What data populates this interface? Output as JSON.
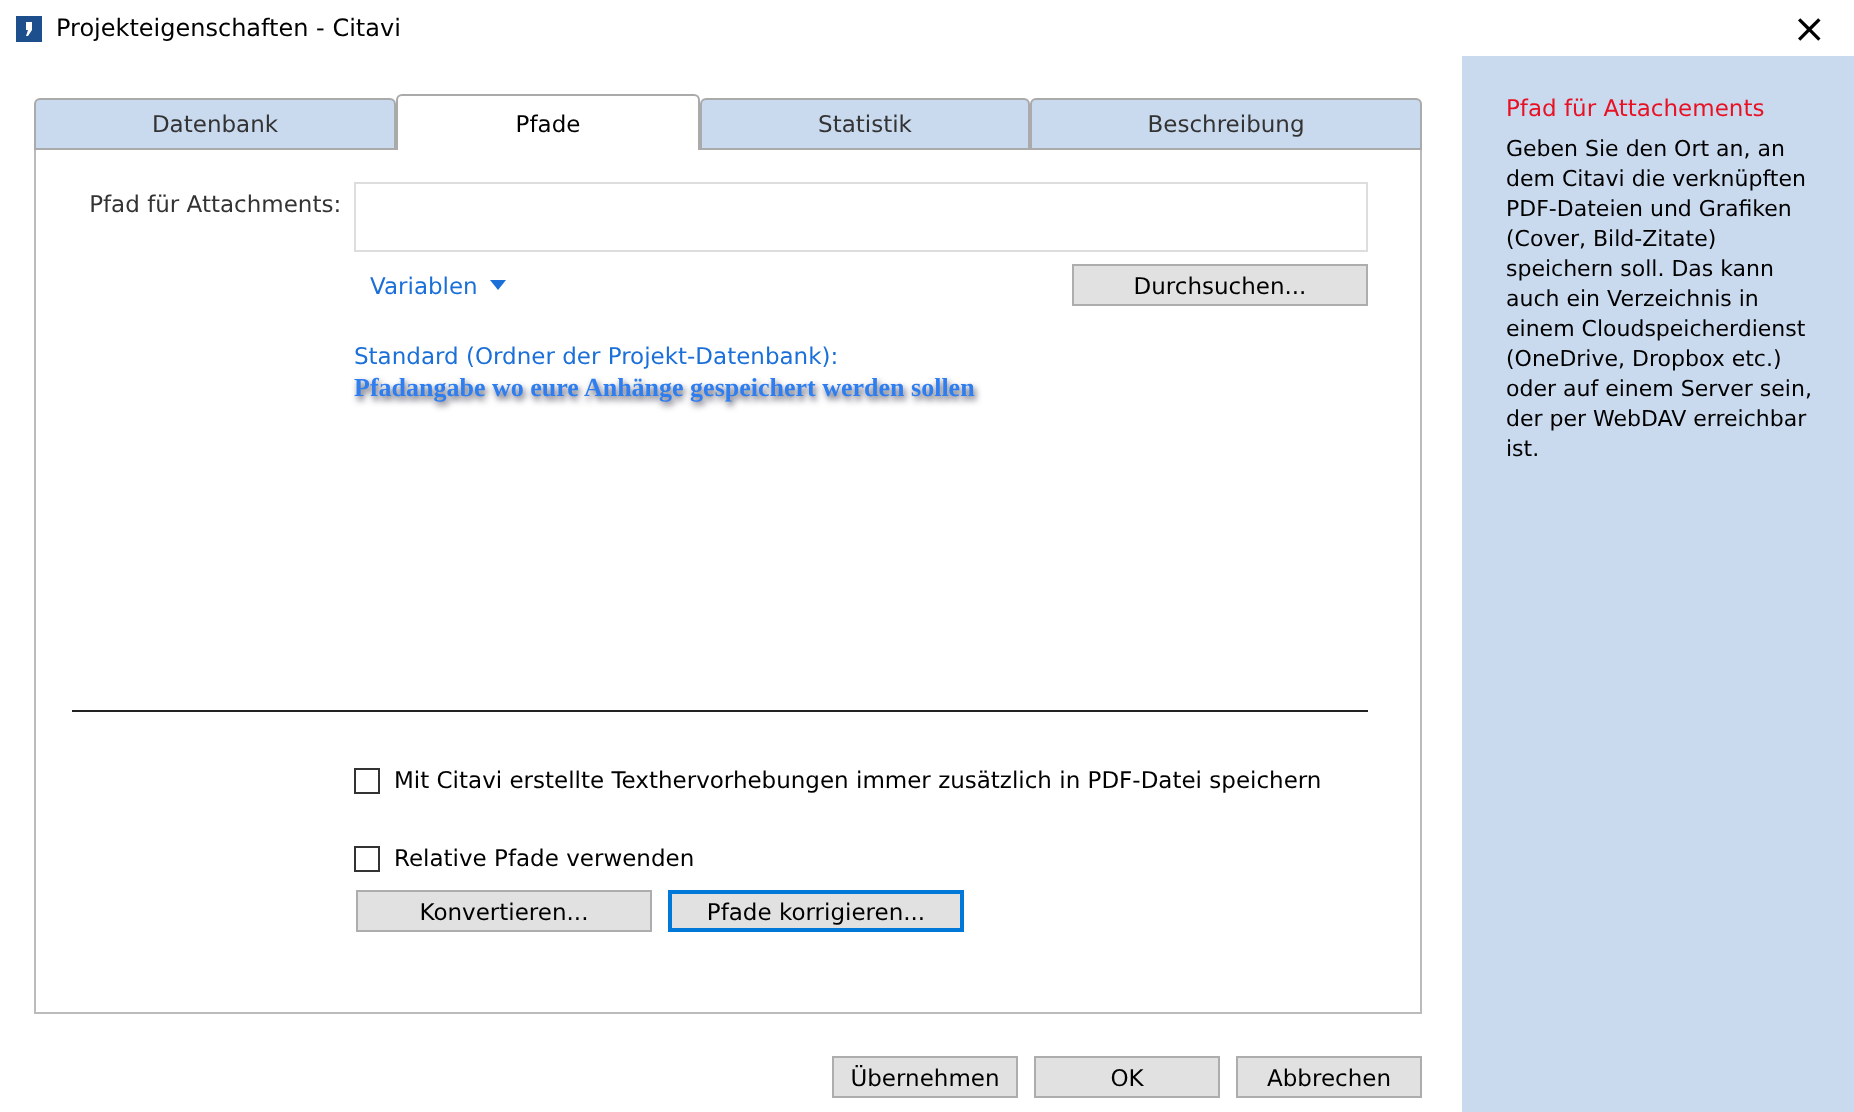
{
  "window": {
    "title": "Projekteigenschaften - Citavi",
    "close": "×"
  },
  "tabs": [
    {
      "label": "Datenbank",
      "selected": false
    },
    {
      "label": "Pfade",
      "selected": true
    },
    {
      "label": "Statistik",
      "selected": false
    },
    {
      "label": "Beschreibung",
      "selected": false
    }
  ],
  "attachment_path": {
    "label": "Pfad für Attachments:",
    "variables": "Variablen",
    "browse": "Durchsuchen...",
    "default_label": "Standard (Ordner der Projekt-Datenbank):",
    "annotation": "Pfadangabe wo eure Anhänge gespeichert werden sollen"
  },
  "checkboxes": [
    {
      "label": "Mit Citavi erstellte Texthervorhebungen immer zusätzlich in PDF-Datei speichern",
      "checked": false
    },
    {
      "label": "Relative Pfade verwenden",
      "checked": false
    }
  ],
  "path_buttons": [
    {
      "label": "Konvertieren...",
      "focused": false
    },
    {
      "label": "Pfade korrigieren...",
      "focused": true
    }
  ],
  "buttons": [
    "Übernehmen",
    "OK",
    "Abbrechen"
  ],
  "help": {
    "title": "Pfad für Attachements",
    "text": "Geben Sie den Ort an, an dem Citavi die verknüpften PDF-Dateien und Grafiken (Cover, Bild-Zitate) speichern soll. Das kann auch ein Verzeichnis in einem Cloudspeicherdienst (OneDrive, Dropbox etc.) oder auf einem Server sein, der per WebDAV erreichbar ist."
  }
}
